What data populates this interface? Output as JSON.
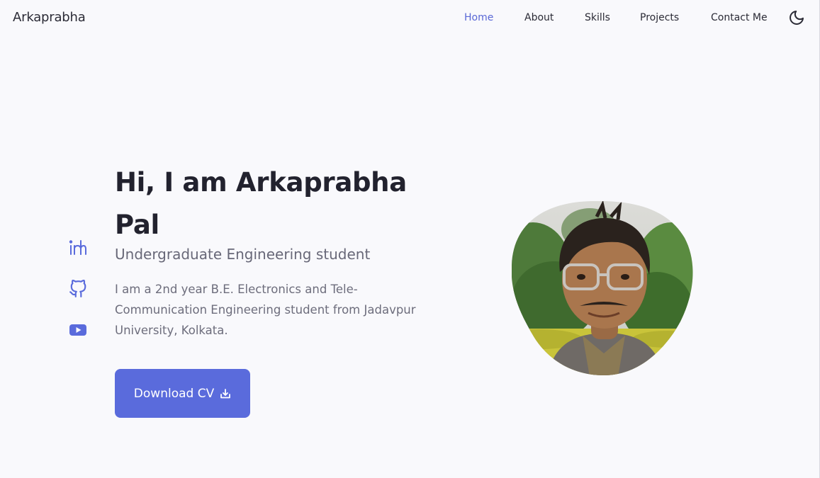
{
  "nav": {
    "logo": "Arkaprabha",
    "links": [
      {
        "label": "Home",
        "active": true
      },
      {
        "label": "About",
        "active": false
      },
      {
        "label": "Skills",
        "active": false
      },
      {
        "label": "Projects",
        "active": false
      },
      {
        "label": "Contact Me",
        "active": false
      }
    ],
    "theme_icon": "moon-icon"
  },
  "social": [
    {
      "icon": "linkedin-icon"
    },
    {
      "icon": "github-icon"
    },
    {
      "icon": "youtube-icon"
    }
  ],
  "hero": {
    "title": "Hi, I am Arkaprabha Pal",
    "subtitle": "Undergraduate Engineering student",
    "description": "I am a 2nd year B.E. Electronics and Tele-Communication Engineering student from Jadavpur University, Kolkata.",
    "cta_label": "Download CV",
    "cta_icon": "download-icon"
  },
  "colors": {
    "accent": "#5a6bdc",
    "background": "#f9f9fc",
    "heading": "#22222e",
    "muted": "#6d6d7c"
  }
}
